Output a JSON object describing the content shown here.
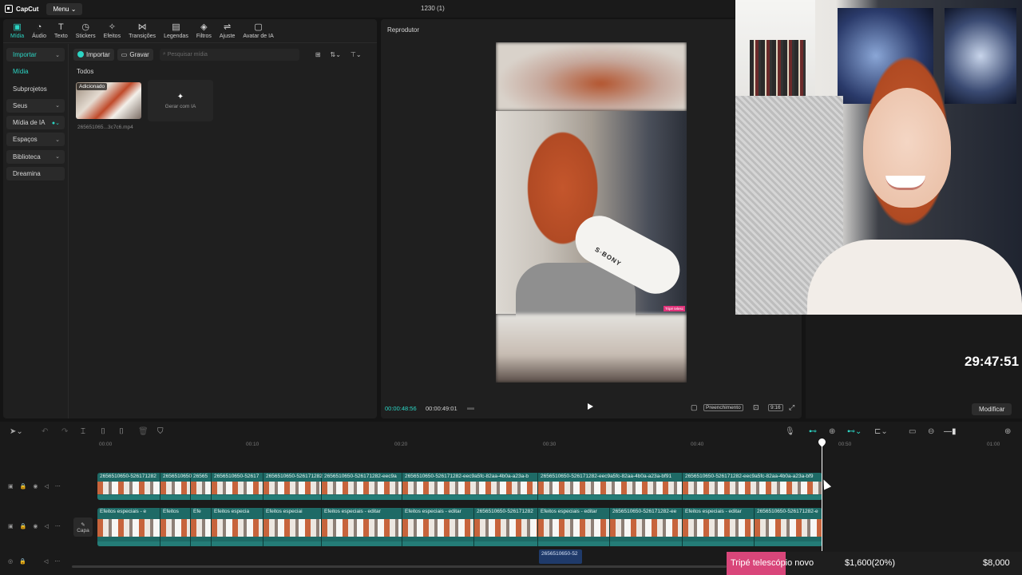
{
  "app": {
    "logo_text": "CapCut",
    "menu_label": "Menu",
    "project_title": "1230 (1)"
  },
  "tabs": [
    {
      "label": "Mídia",
      "icon": "media-icon"
    },
    {
      "label": "Áudio",
      "icon": "audio-icon"
    },
    {
      "label": "Texto",
      "icon": "text-icon"
    },
    {
      "label": "Stickers",
      "icon": "sticker-icon"
    },
    {
      "label": "Efeitos",
      "icon": "effects-icon"
    },
    {
      "label": "Transições",
      "icon": "transition-icon"
    },
    {
      "label": "Legendas",
      "icon": "captions-icon"
    },
    {
      "label": "Filtros",
      "icon": "filter-icon"
    },
    {
      "label": "Ajuste",
      "icon": "adjust-icon"
    },
    {
      "label": "Avatar de IA",
      "icon": "avatar-icon"
    }
  ],
  "sidebar": {
    "items": [
      {
        "label": "Importar"
      },
      {
        "label": "Mídia"
      },
      {
        "label": "Subprojetos"
      },
      {
        "label": "Seus"
      },
      {
        "label": "Mídia de IA"
      },
      {
        "label": "Espaços"
      },
      {
        "label": "Biblioteca"
      },
      {
        "label": "Dreamina"
      }
    ]
  },
  "media": {
    "import_label": "Importar",
    "record_label": "Gravar",
    "search_placeholder": "Pesquisar mídia",
    "section_label": "Todos",
    "clip_badge": "Adicionado",
    "clip_name": "2656510​65...3c7c6.mp4",
    "gen_ia_label": "Gerar com IA"
  },
  "player": {
    "title": "Reprodutor",
    "current_time": "00:00:48:56",
    "total_time": "00:00:49:01",
    "fill_label": "Preenchimento",
    "ratio_label": "9:16",
    "video_overlay_text": "S◦BONY",
    "video_tag": "Tripé telesc"
  },
  "right": {
    "clock": "29:47:51",
    "modify_label": "Modificar"
  },
  "timeline": {
    "ruler": [
      "00:00",
      "00:10",
      "00:20",
      "00:30",
      "00:40",
      "00:50",
      "01:00"
    ],
    "video_clips": [
      "2656510650-526171282",
      "2656510650",
      "26565",
      "2656510650-52617",
      "2656510650-526171282",
      "2656510650-526171282-eec9a",
      "2656510650-526171282-eec9a5fc-82aa-4b0a-a23a-b",
      "2656510650-526171282-eec9a5fc-82aa-4b0a-a23a-bf91",
      "2656510650-526171282-eec9a5fc-82aa-4b0a-a23a-bf9"
    ],
    "effect_clips": [
      "Efeitos especiais - e",
      "Efeitos",
      "Efe",
      "Efeitos especia",
      "Efeitos especiai",
      "Efeitos especiais - editar",
      "Efeitos especiais - editar",
      "2656510650-526171282",
      "Efeitos especiais - editar",
      "2656510650-526171282-ee",
      "Efeitos especiais - editar",
      "2656510650-526171282-e"
    ],
    "cover_label": "Capa",
    "audio_clip": "2656510650-52"
  },
  "goal": {
    "name": "Tripé telescópio novo",
    "current": "$1,600(20%)",
    "target": "$8,000",
    "progress_fraction": 0.2,
    "accent": "#d9467a"
  },
  "colors": {
    "accent": "#2cd5c4",
    "track": "#1e6a66"
  }
}
